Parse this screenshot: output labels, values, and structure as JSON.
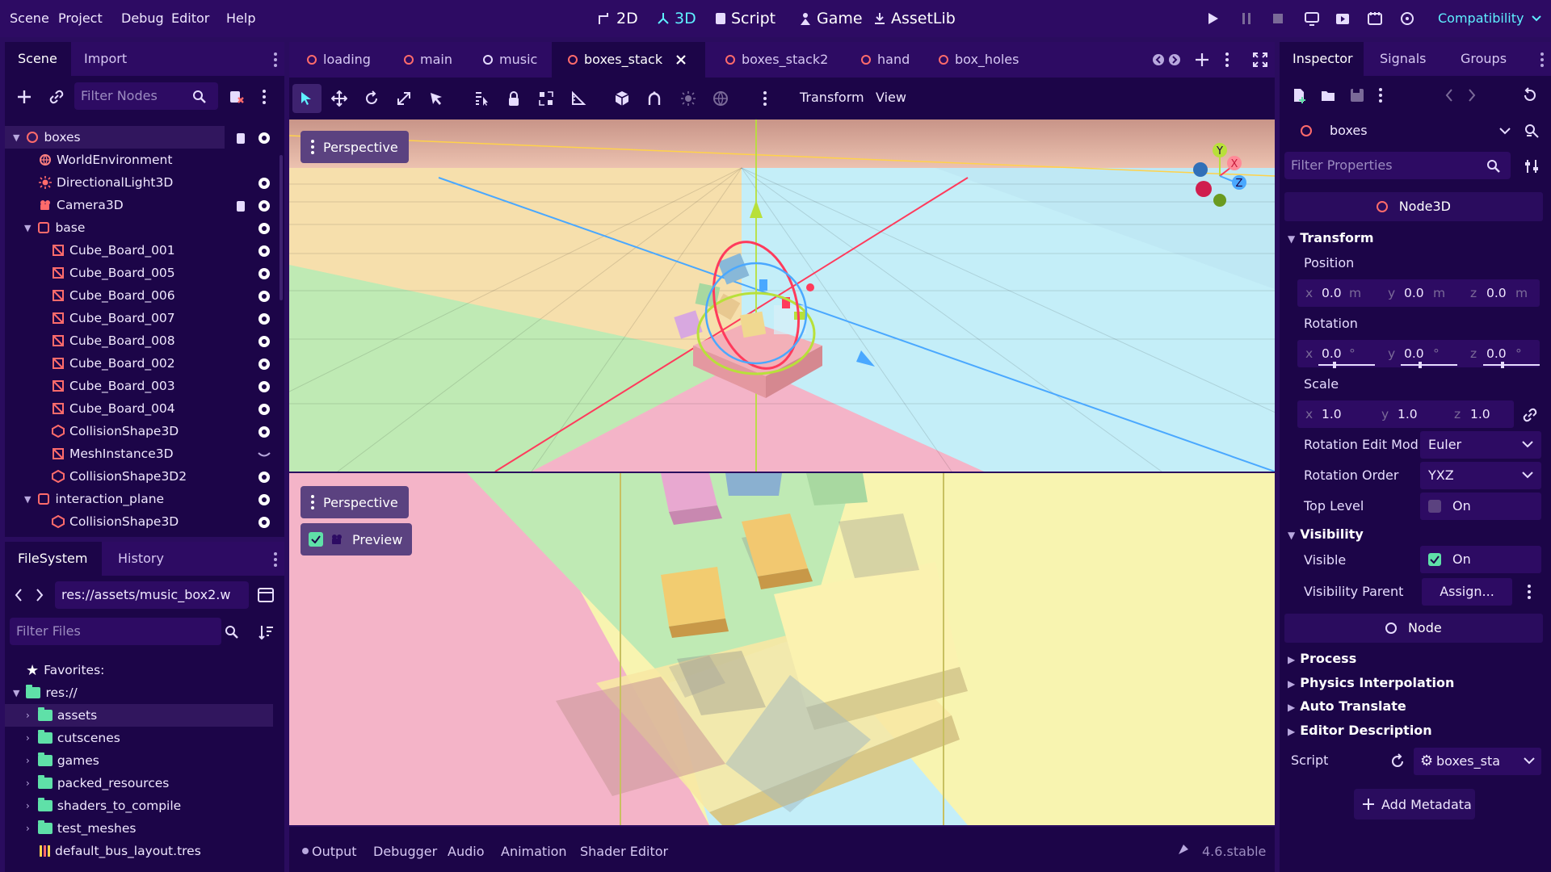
{
  "menu": [
    "Scene",
    "Project",
    "Debug",
    "Editor",
    "Help"
  ],
  "modes": [
    {
      "label": "2D"
    },
    {
      "label": "3D"
    },
    {
      "label": "Script"
    },
    {
      "label": "Game"
    },
    {
      "label": "AssetLib"
    }
  ],
  "renderer": "Compatibility",
  "colors": {
    "accent": "#5ff0ff",
    "panel": "#1c0548",
    "bar": "#2d0b63",
    "node_red": "#ff6b6b",
    "folder": "#5fe0a8"
  },
  "scene_dock": {
    "tabs": [
      "Scene",
      "Import"
    ],
    "filter_placeholder": "Filter Nodes",
    "nodes": [
      {
        "label": "boxes",
        "icon": "node3d-icon",
        "depth": 0,
        "expand": "v"
      },
      {
        "label": "WorldEnvironment",
        "icon": "world-environment-icon",
        "depth": 1
      },
      {
        "label": "DirectionalLight3D",
        "icon": "directional-light-icon",
        "depth": 1
      },
      {
        "label": "Camera3D",
        "icon": "camera-icon",
        "depth": 1
      },
      {
        "label": "base",
        "icon": "static-body-icon",
        "depth": 1,
        "expand": "v"
      },
      {
        "label": "Cube_Board_001",
        "icon": "mesh-instance-icon",
        "depth": 2
      },
      {
        "label": "Cube_Board_005",
        "icon": "mesh-instance-icon",
        "depth": 2
      },
      {
        "label": "Cube_Board_006",
        "icon": "mesh-instance-icon",
        "depth": 2
      },
      {
        "label": "Cube_Board_007",
        "icon": "mesh-instance-icon",
        "depth": 2
      },
      {
        "label": "Cube_Board_008",
        "icon": "mesh-instance-icon",
        "depth": 2
      },
      {
        "label": "Cube_Board_002",
        "icon": "mesh-instance-icon",
        "depth": 2
      },
      {
        "label": "Cube_Board_003",
        "icon": "mesh-instance-icon",
        "depth": 2
      },
      {
        "label": "Cube_Board_004",
        "icon": "mesh-instance-icon",
        "depth": 2
      },
      {
        "label": "CollisionShape3D",
        "icon": "collision-shape-icon",
        "depth": 2
      },
      {
        "label": "MeshInstance3D",
        "icon": "mesh-instance-icon",
        "depth": 2
      },
      {
        "label": "CollisionShape3D2",
        "icon": "collision-shape-icon",
        "depth": 2
      },
      {
        "label": "interaction_plane",
        "icon": "static-body-icon",
        "depth": 1,
        "expand": "v"
      },
      {
        "label": "CollisionShape3D",
        "icon": "collision-shape-icon",
        "depth": 2
      }
    ]
  },
  "filesystem": {
    "tabs": [
      "FileSystem",
      "History"
    ],
    "path": "res://assets/music_box2.w",
    "filter_placeholder": "Filter Files",
    "favorites": "Favorites:",
    "root": "res://",
    "folders": [
      "assets",
      "cutscenes",
      "games",
      "packed_resources",
      "shaders_to_compile",
      "test_meshes"
    ],
    "file": "default_bus_layout.tres"
  },
  "scene_tabs": [
    "loading",
    "main",
    "music",
    "boxes_stack",
    "boxes_stack2",
    "hand",
    "box_holes"
  ],
  "viewport_menu": [
    "Transform",
    "View"
  ],
  "viewport": {
    "top_label": "Perspective",
    "bottom_label": "Perspective",
    "preview_label": "Preview"
  },
  "gizmo": {
    "y": "Y",
    "x": "X",
    "z": "Z"
  },
  "inspector": {
    "tabs": [
      "Inspector",
      "Signals",
      "Groups"
    ],
    "node_name": "boxes",
    "filter_placeholder": "Filter Properties",
    "class_name": "Node3D",
    "section_transform": "Transform",
    "position_label": "Position",
    "position": {
      "x": "0.0",
      "y": "0.0",
      "z": "0.0",
      "unit": "m"
    },
    "rotation_label": "Rotation",
    "rotation": {
      "x": "0.0",
      "y": "0.0",
      "z": "0.0",
      "unit": "°"
    },
    "scale_label": "Scale",
    "scale": {
      "x": "1.0",
      "y": "1.0",
      "z": "1.0"
    },
    "rotation_edit_mode_label": "Rotation Edit Mod",
    "rotation_edit_mode": "Euler",
    "rotation_order_label": "Rotation Order",
    "rotation_order": "YXZ",
    "top_level_label": "Top Level",
    "top_level_value": "On",
    "section_visibility": "Visibility",
    "visible_label": "Visible",
    "visible_value": "On",
    "visibility_parent_label": "Visibility Parent",
    "visibility_parent_value": "Assign...",
    "node_class": "Node",
    "collapsed_sections": [
      "Process",
      "Physics Interpolation",
      "Auto Translate",
      "Editor Description"
    ],
    "script_label": "Script",
    "script_value": "boxes_sta",
    "add_metadata": "Add Metadata"
  },
  "bottom_panel": {
    "tabs": [
      "Output",
      "Debugger",
      "Audio",
      "Animation",
      "Shader Editor"
    ],
    "version": "4.6.stable"
  }
}
